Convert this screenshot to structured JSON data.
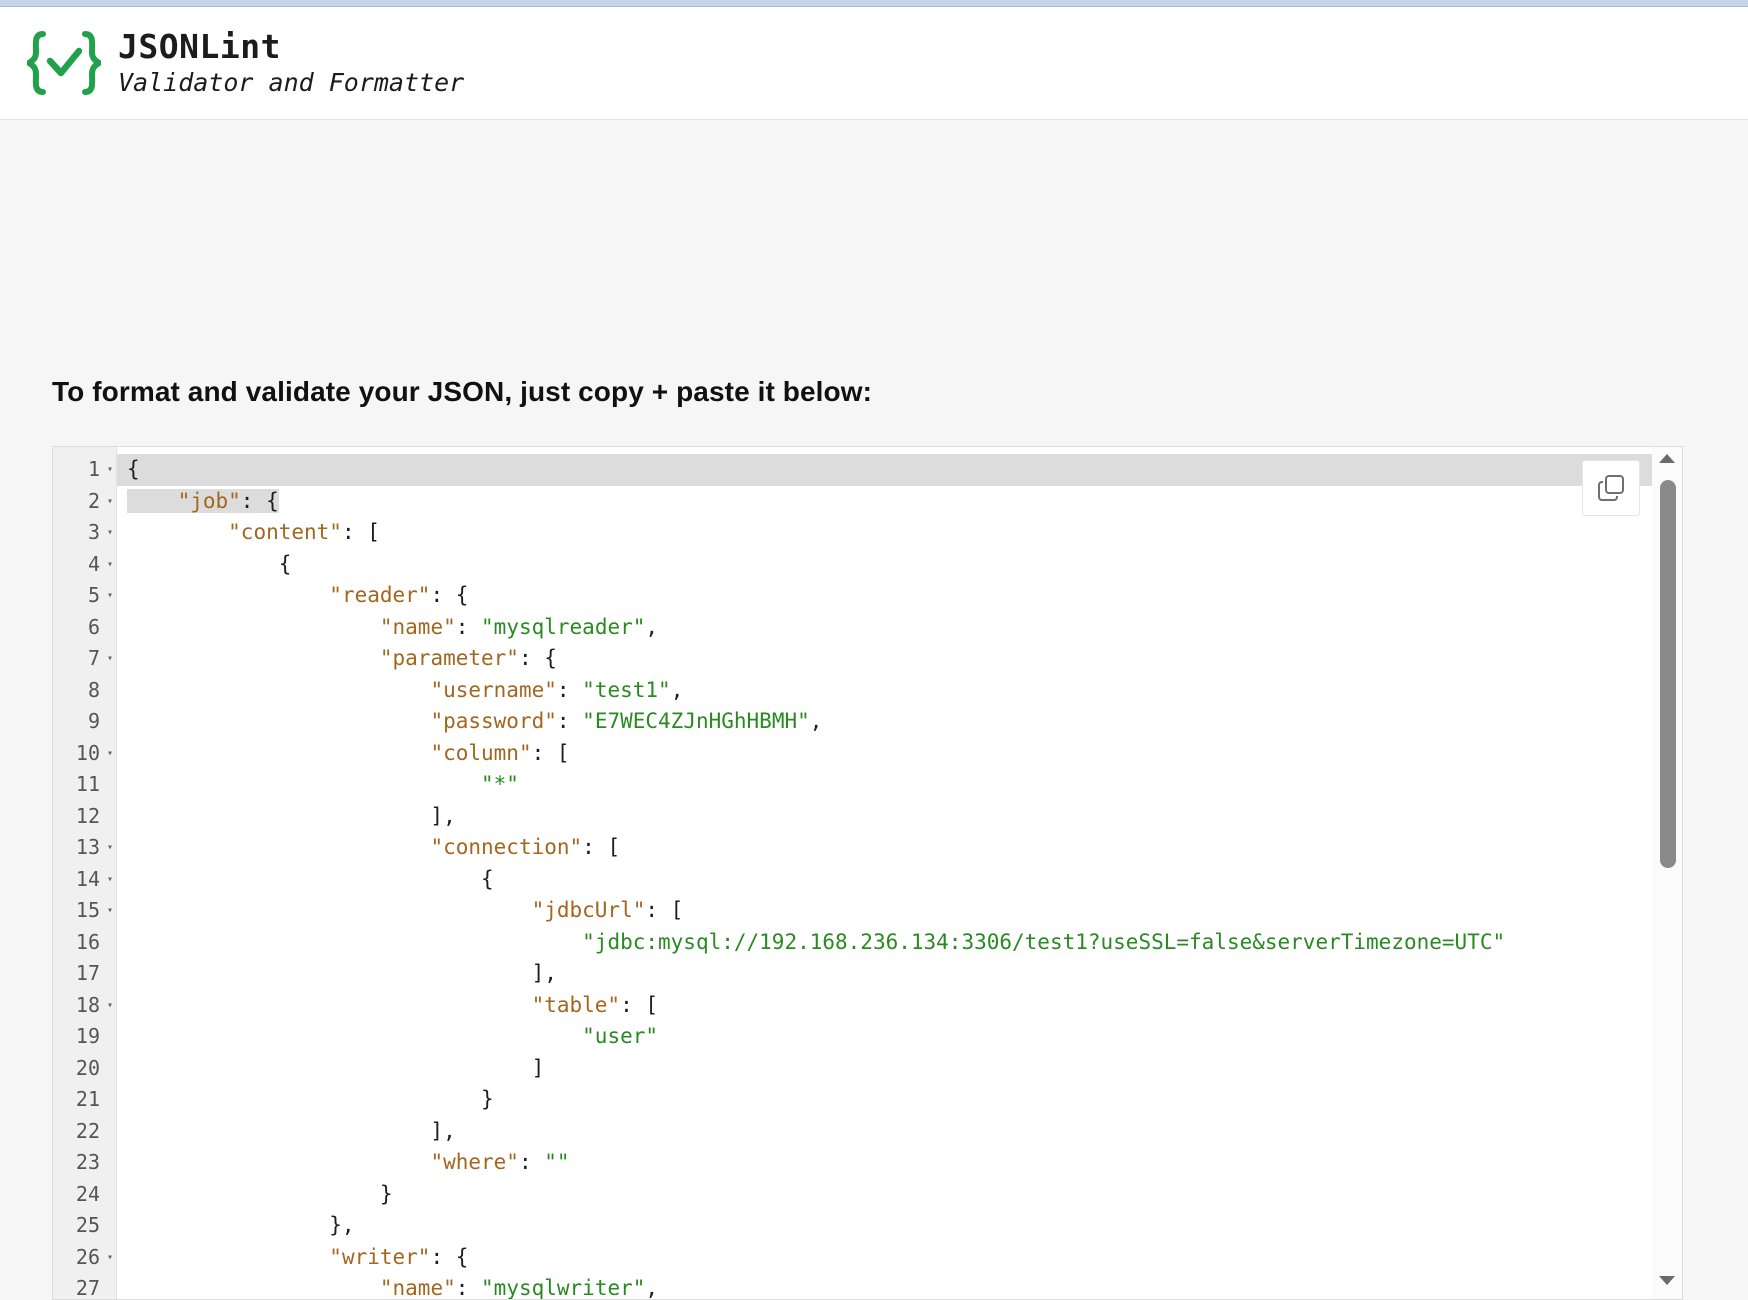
{
  "header": {
    "title": "JSONLint",
    "subtitle": "Validator and Formatter",
    "logo_icon": "braces-check-icon",
    "accent": "#21a14b"
  },
  "instruction": "To format and validate your JSON, just copy + paste it below:",
  "editor": {
    "copy_icon": "copy-icon",
    "colors": {
      "key": "#a3661f",
      "string": "#2a8a22",
      "punct": "#1e1e1e"
    },
    "lines": [
      {
        "n": "1",
        "fold": true,
        "tokens": [
          {
            "t": "p",
            "v": "{"
          }
        ]
      },
      {
        "n": "2",
        "fold": true,
        "tokens": [
          {
            "t": "p",
            "v": "    "
          },
          {
            "t": "k",
            "v": "\"job\""
          },
          {
            "t": "p",
            "v": ": {"
          }
        ]
      },
      {
        "n": "3",
        "fold": true,
        "tokens": [
          {
            "t": "p",
            "v": "        "
          },
          {
            "t": "k",
            "v": "\"content\""
          },
          {
            "t": "p",
            "v": ": ["
          }
        ]
      },
      {
        "n": "4",
        "fold": true,
        "tokens": [
          {
            "t": "p",
            "v": "            {"
          }
        ]
      },
      {
        "n": "5",
        "fold": true,
        "tokens": [
          {
            "t": "p",
            "v": "                "
          },
          {
            "t": "k",
            "v": "\"reader\""
          },
          {
            "t": "p",
            "v": ": {"
          }
        ]
      },
      {
        "n": "6",
        "fold": false,
        "tokens": [
          {
            "t": "p",
            "v": "                    "
          },
          {
            "t": "k",
            "v": "\"name\""
          },
          {
            "t": "p",
            "v": ": "
          },
          {
            "t": "s",
            "v": "\"mysqlreader\""
          },
          {
            "t": "p",
            "v": ","
          }
        ]
      },
      {
        "n": "7",
        "fold": true,
        "tokens": [
          {
            "t": "p",
            "v": "                    "
          },
          {
            "t": "k",
            "v": "\"parameter\""
          },
          {
            "t": "p",
            "v": ": {"
          }
        ]
      },
      {
        "n": "8",
        "fold": false,
        "tokens": [
          {
            "t": "p",
            "v": "                        "
          },
          {
            "t": "k",
            "v": "\"username\""
          },
          {
            "t": "p",
            "v": ": "
          },
          {
            "t": "s",
            "v": "\"test1\""
          },
          {
            "t": "p",
            "v": ","
          }
        ]
      },
      {
        "n": "9",
        "fold": false,
        "tokens": [
          {
            "t": "p",
            "v": "                        "
          },
          {
            "t": "k",
            "v": "\"password\""
          },
          {
            "t": "p",
            "v": ": "
          },
          {
            "t": "s",
            "v": "\"E7WEC4ZJnHGhHBMH\""
          },
          {
            "t": "p",
            "v": ","
          }
        ]
      },
      {
        "n": "10",
        "fold": true,
        "tokens": [
          {
            "t": "p",
            "v": "                        "
          },
          {
            "t": "k",
            "v": "\"column\""
          },
          {
            "t": "p",
            "v": ": ["
          }
        ]
      },
      {
        "n": "11",
        "fold": false,
        "tokens": [
          {
            "t": "p",
            "v": "                            "
          },
          {
            "t": "s",
            "v": "\"*\""
          }
        ]
      },
      {
        "n": "12",
        "fold": false,
        "tokens": [
          {
            "t": "p",
            "v": "                        ],"
          }
        ]
      },
      {
        "n": "13",
        "fold": true,
        "tokens": [
          {
            "t": "p",
            "v": "                        "
          },
          {
            "t": "k",
            "v": "\"connection\""
          },
          {
            "t": "p",
            "v": ": ["
          }
        ]
      },
      {
        "n": "14",
        "fold": true,
        "tokens": [
          {
            "t": "p",
            "v": "                            {"
          }
        ]
      },
      {
        "n": "15",
        "fold": true,
        "tokens": [
          {
            "t": "p",
            "v": "                                "
          },
          {
            "t": "k",
            "v": "\"jdbcUrl\""
          },
          {
            "t": "p",
            "v": ": ["
          }
        ]
      },
      {
        "n": "16",
        "fold": false,
        "tokens": [
          {
            "t": "p",
            "v": "                                    "
          },
          {
            "t": "s",
            "v": "\"jdbc:mysql://192.168.236.134:3306/test1?useSSL=false&serverTimezone=UTC\""
          }
        ]
      },
      {
        "n": "17",
        "fold": false,
        "tokens": [
          {
            "t": "p",
            "v": "                                ],"
          }
        ]
      },
      {
        "n": "18",
        "fold": true,
        "tokens": [
          {
            "t": "p",
            "v": "                                "
          },
          {
            "t": "k",
            "v": "\"table\""
          },
          {
            "t": "p",
            "v": ": ["
          }
        ]
      },
      {
        "n": "19",
        "fold": false,
        "tokens": [
          {
            "t": "p",
            "v": "                                    "
          },
          {
            "t": "s",
            "v": "\"user\""
          }
        ]
      },
      {
        "n": "20",
        "fold": false,
        "tokens": [
          {
            "t": "p",
            "v": "                                ]"
          }
        ]
      },
      {
        "n": "21",
        "fold": false,
        "tokens": [
          {
            "t": "p",
            "v": "                            }"
          }
        ]
      },
      {
        "n": "22",
        "fold": false,
        "tokens": [
          {
            "t": "p",
            "v": "                        ],"
          }
        ]
      },
      {
        "n": "23",
        "fold": false,
        "tokens": [
          {
            "t": "p",
            "v": "                        "
          },
          {
            "t": "k",
            "v": "\"where\""
          },
          {
            "t": "p",
            "v": ": "
          },
          {
            "t": "s",
            "v": "\"\""
          }
        ]
      },
      {
        "n": "24",
        "fold": false,
        "tokens": [
          {
            "t": "p",
            "v": "                    }"
          }
        ]
      },
      {
        "n": "25",
        "fold": false,
        "tokens": [
          {
            "t": "p",
            "v": "                },"
          }
        ]
      },
      {
        "n": "26",
        "fold": true,
        "tokens": [
          {
            "t": "p",
            "v": "                "
          },
          {
            "t": "k",
            "v": "\"writer\""
          },
          {
            "t": "p",
            "v": ": {"
          }
        ]
      },
      {
        "n": "27",
        "fold": false,
        "tokens": [
          {
            "t": "p",
            "v": "                    "
          },
          {
            "t": "k",
            "v": "\"name\""
          },
          {
            "t": "p",
            "v": ": "
          },
          {
            "t": "s",
            "v": "\"mysqlwriter\""
          },
          {
            "t": "p",
            "v": ","
          }
        ]
      }
    ]
  }
}
